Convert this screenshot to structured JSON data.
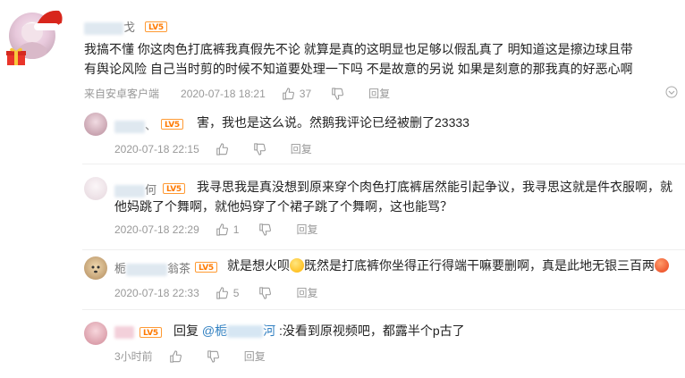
{
  "main_comment": {
    "level": "LV5",
    "text": "我搞不懂 你这肉色打底裤我真假先不论 就算是真的这明显也足够以假乱真了 明知道这是擦边球且带有舆论风险 自己当时剪的时候不知道要处理一下吗 不是故意的另说 如果是刻意的那我真的好恶心啊",
    "source": "来自安卓客户端",
    "time": "2020-07-18 18:21",
    "likes": "37",
    "reply_label": "回复"
  },
  "replies": [
    {
      "level": "LV5",
      "text": "害，我也是这么说。然鹅我评论已经被删了23333",
      "time": "2020-07-18 22:15",
      "likes": "",
      "reply_label": "回复"
    },
    {
      "level": "LV5",
      "text": "我寻思我是真没想到原来穿个肉色打底裤居然能引起争议，我寻思这就是件衣服啊，就他妈跳了个舞啊，就他妈穿了个裙子跳了个舞啊，这也能骂？",
      "time": "2020-07-18 22:29",
      "likes": "1",
      "reply_label": "回复"
    },
    {
      "level": "LV5",
      "text_a": "就是想火呗",
      "text_b": "既然是打底裤你坐得正行得端干嘛要删啊，真是此地无银三百两",
      "time": "2020-07-18 22:33",
      "likes": "5",
      "reply_label": "回复"
    },
    {
      "level": "LV5",
      "reply_prefix": "回复",
      "mention": "@",
      "mention_tail": "河",
      "text": ":没看到原视频吧，都露半个p古了",
      "time": "3小时前",
      "likes": "",
      "reply_label": "回复"
    }
  ],
  "partial_names": {
    "main_tail": "戈",
    "r1_tail": "、",
    "r2_tail": "何",
    "r3_head": "栀",
    "r3_tail": "翁茶"
  },
  "colors": {
    "level_badge": "#ff7a00",
    "mention": "#2f7fc1",
    "meta_text": "#999999"
  }
}
